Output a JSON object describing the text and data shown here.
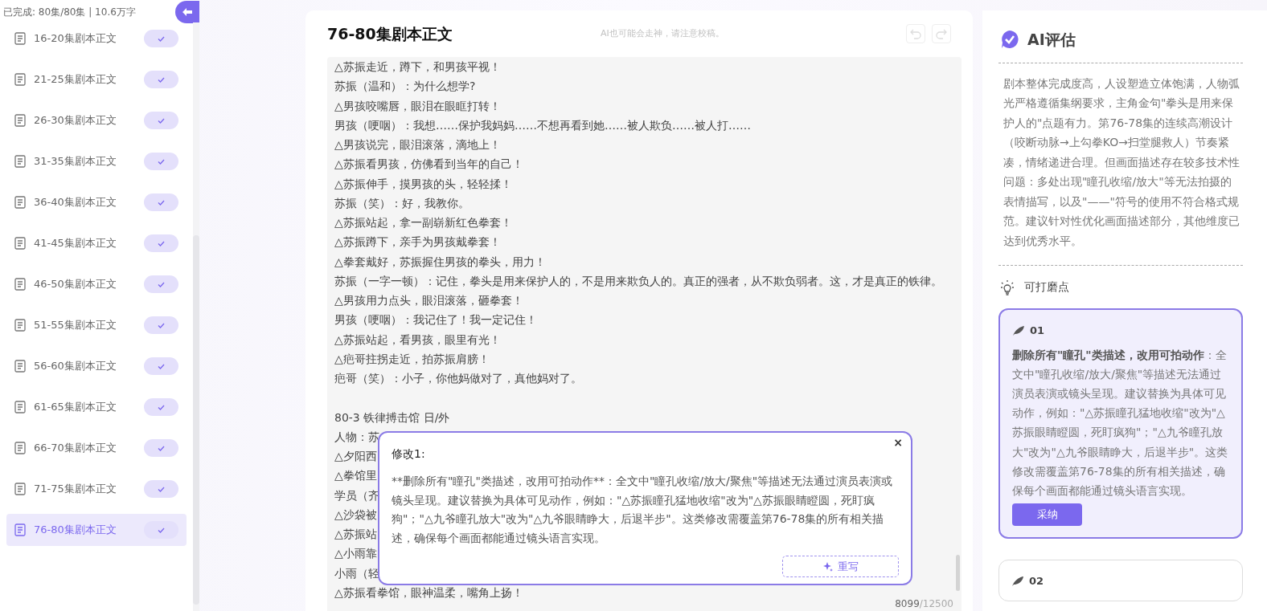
{
  "sidebar": {
    "progress": "已完成: 80集/80集 | 10.6万字",
    "items": [
      {
        "label": "16-20集剧本正文",
        "done": true,
        "selected": false
      },
      {
        "label": "21-25集剧本正文",
        "done": true,
        "selected": false
      },
      {
        "label": "26-30集剧本正文",
        "done": true,
        "selected": false
      },
      {
        "label": "31-35集剧本正文",
        "done": true,
        "selected": false
      },
      {
        "label": "36-40集剧本正文",
        "done": true,
        "selected": false
      },
      {
        "label": "41-45集剧本正文",
        "done": true,
        "selected": false
      },
      {
        "label": "46-50集剧本正文",
        "done": true,
        "selected": false
      },
      {
        "label": "51-55集剧本正文",
        "done": true,
        "selected": false
      },
      {
        "label": "56-60集剧本正文",
        "done": true,
        "selected": false
      },
      {
        "label": "61-65集剧本正文",
        "done": true,
        "selected": false
      },
      {
        "label": "66-70集剧本正文",
        "done": true,
        "selected": false
      },
      {
        "label": "71-75集剧本正文",
        "done": true,
        "selected": false
      },
      {
        "label": "76-80集剧本正文",
        "done": true,
        "selected": true
      }
    ]
  },
  "editor": {
    "title": "76-80集剧本正文",
    "notice": "AI也可能会走神，请注意校稿。",
    "undo_disabled": true,
    "redo_disabled": true,
    "lines": [
      "△苏振走近，蹲下，和男孩平视！",
      "苏振（温和）：为什么想学?",
      "△男孩咬嘴唇，眼泪在眼眶打转！",
      "男孩（哽咽）：我想……保护我妈妈……不想再看到她……被人欺负……被人打……",
      "△男孩说完，眼泪滚落，滴地上！",
      "△苏振看男孩，仿佛看到当年的自己！",
      "△苏振伸手，摸男孩的头，轻轻揉！",
      "苏振（笑）：好，我教你。",
      "△苏振站起，拿一副崭新红色拳套！",
      "△苏振蹲下，亲手为男孩戴拳套！",
      "△拳套戴好，苏振握住男孩的拳头，用力！",
      "苏振（一字一顿）：记住，拳头是用来保护人的，不是用来欺负人的。真正的强者，从不欺负弱者。这，才是真正的铁律。",
      "△男孩用力点头，眼泪滚落，砸拳套！",
      "男孩（哽咽）：我记住了！我一定记住！",
      "△苏振站起，看男孩，眼里有光！",
      "△疤哥拄拐走近，拍苏振肩膀！",
      "疤哥（笑）：小子，你他妈做对了，真他妈对了。"
    ],
    "next_scene_lines": [
      "80-3 铁律搏击馆 日/外",
      "人物：苏",
      "△夕阳西",
      "△拳馆里",
      "学员（齐",
      "△沙袋被",
      "△苏振站",
      "△小雨靠",
      "小雨（轻",
      "△苏振看拳馆，眼神温柔，嘴角上扬！"
    ],
    "count": "8099",
    "limit": "/12500"
  },
  "popup": {
    "title": "修改1:",
    "close": "×",
    "body": "**删除所有\"瞳孔\"类描述，改用可拍动作**：全文中\"瞳孔收缩/放大/聚焦\"等描述无法通过演员表演或镜头呈现。建议替换为具体可见动作，例如：\"△苏振瞳孔猛地收缩\"改为\"△苏振眼睛瞪圆，死盯疯狗\"；\"△九爷瞳孔放大\"改为\"△九爷眼睛睁大，后退半步\"。这类修改需覆盖第76-78集的所有相关描述，确保每个画面都能通过镜头语言实现。",
    "button": "重写"
  },
  "evaluation": {
    "title": "AI评估",
    "summary": "剧本整体完成度高，人设塑造立体饱满，人物弧光严格遵循集纲要求，主角金句\"拳头是用来保护人的\"点题有力。第76-78集的连续高潮设计（咬断动脉→上勾拳KO→扫堂腿救人）节奏紧凑，情绪递进合理。但画面描述存在较多技术性问题：多处出现\"瞳孔收缩/放大\"等无法拍摄的表情描写，以及\"——\"符号的使用不符合格式规范。建议针对性优化画面描述部分，其他维度已达到优秀水平。",
    "section": "可打磨点",
    "suggestions": [
      {
        "number": "01",
        "selected": true,
        "text": "**删除所有\"瞳孔\"类描述，改用可拍动作**：全文中\"瞳孔收缩/放大/聚焦\"等描述无法通过演员表演或镜头呈现。建议替换为具体可见动作，例如：\"△苏振瞳孔猛地收缩\"改为\"△苏振眼睛瞪圆，死盯疯狗\"；\"△九爷瞳孔放大\"改为\"△九爷眼睛睁大，后退半步\"。这类修改需覆盖第76-78集的所有相关描述，确保每个画面都能通过镜头语言实现。",
        "button": "采纳"
      },
      {
        "number": "02",
        "selected": false
      }
    ]
  }
}
